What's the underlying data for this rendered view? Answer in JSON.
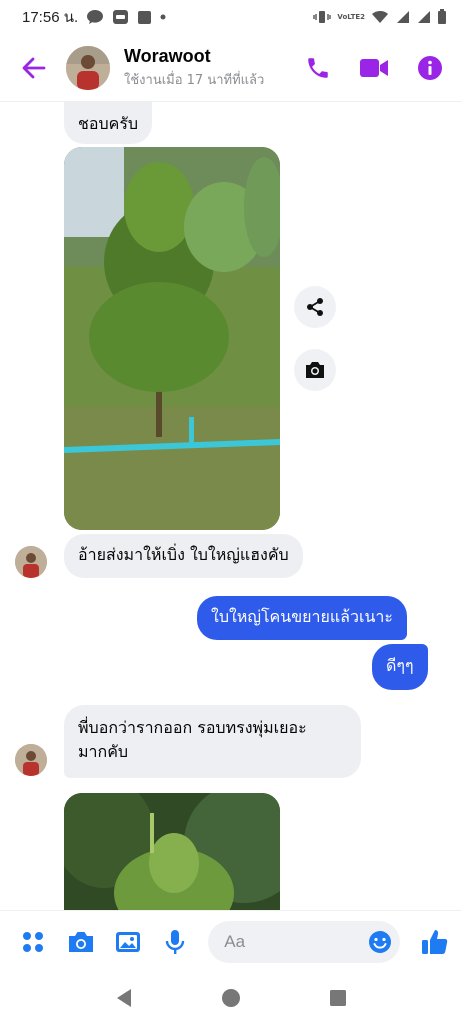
{
  "status_bar": {
    "time": "17:56 น.",
    "network_label": "VoLTE2"
  },
  "header": {
    "contact_name": "Worawoot",
    "contact_status": "ใช้งานเมื่อ 17 นาทีที่แล้ว"
  },
  "messages": [
    {
      "id": "m1",
      "direction": "incoming",
      "type": "text",
      "text": "ชอบครับ"
    },
    {
      "id": "m2",
      "direction": "incoming",
      "type": "photo",
      "alt": "durian-tree-photo"
    },
    {
      "id": "m3",
      "direction": "incoming",
      "type": "text",
      "text": "อ้ายส่งมาให้เบิ่ง ใบใหญ่แฮงคับ"
    },
    {
      "id": "m4",
      "direction": "outgoing",
      "type": "text",
      "text": "ใบใหญ่โคนขยายแล้วเนาะ"
    },
    {
      "id": "m5",
      "direction": "outgoing",
      "type": "text",
      "text": "ดีๆๆ"
    },
    {
      "id": "m6",
      "direction": "incoming",
      "type": "text",
      "text_line1": "พี่บอกว่ารากออก รอบทรงพุ่มเยอะ",
      "text_line2": "มากคับ"
    },
    {
      "id": "m7",
      "direction": "incoming",
      "type": "photo",
      "alt": "durian-tree-photo-2"
    }
  ],
  "composer": {
    "placeholder": "Aa"
  },
  "colors": {
    "accent": "#9b25e6",
    "outgoing_bubble": "#2f5bea",
    "incoming_bubble": "#eeeff3",
    "composer_icons": "#1f7bf2"
  },
  "icons": {
    "back": "arrow-left-icon",
    "call": "phone-icon",
    "video": "video-camera-icon",
    "info": "info-icon",
    "share": "share-icon",
    "camera": "camera-icon",
    "menu": "four-dots-icon",
    "gallery": "image-icon",
    "mic": "microphone-icon",
    "emoji": "smiley-icon",
    "like": "thumbs-up-icon"
  }
}
